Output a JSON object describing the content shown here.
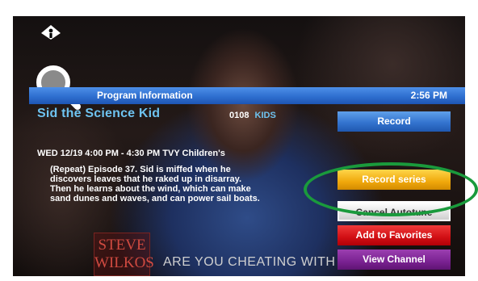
{
  "header": {
    "title": "Program Information",
    "time": "2:56 PM"
  },
  "program": {
    "title": "Sid the Science Kid",
    "channel_number": "0108",
    "channel_name": "KIDS",
    "airtime": "WED 12/19 4:00 PM - 4:30 PM  TVY  Children's",
    "description": "(Repeat) Episode 37. Sid is miffed when he discovers leaves that he raked up in disarray. Then he learns about the wind, which can make sand dunes and waves, and can power sail boats."
  },
  "background_video": {
    "watermark_line1": "STEVE",
    "watermark_line2": "WILKOS",
    "tagline": "ARE YOU CHEATING WITH MY FAMILY?"
  },
  "actions": {
    "record": "Record",
    "record_series": "Record series",
    "cancel_autotune": "Cancel Autotune",
    "add_to_favorites": "Add to Favorites",
    "view_channel": "View Channel"
  },
  "icons": {
    "logo": "provider-logo-icon",
    "search": "search-icon"
  },
  "colors": {
    "header_bar": "#2f6fd0",
    "title_text": "#6ec3f0",
    "record": "#3474cf",
    "record_series": "#f0a80c",
    "cancel_autotune": "#e8e8e8",
    "add_to_favorites": "#d10f14",
    "view_channel": "#7a2292",
    "highlight_ring": "#1a9a3c"
  }
}
